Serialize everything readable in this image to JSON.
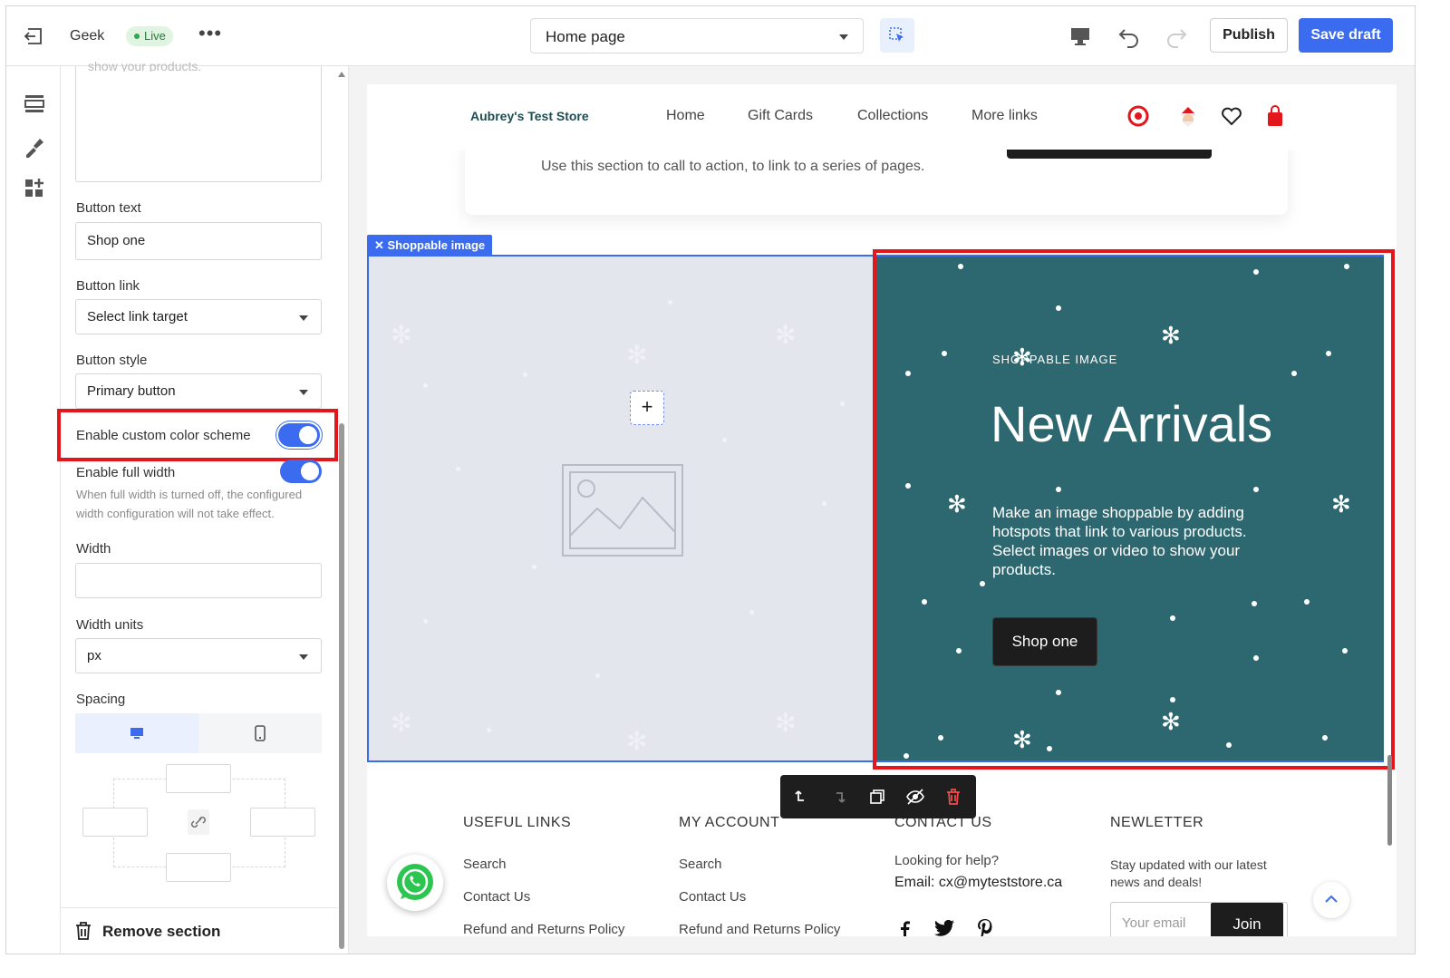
{
  "topbar": {
    "store_name": "Geek",
    "live_badge": "Live",
    "more": "•••",
    "page_select": "Home page",
    "publish": "Publish",
    "save_draft": "Save draft"
  },
  "panel": {
    "textarea_ghost": "show your products.",
    "button_text_label": "Button text",
    "button_text_value": "Shop one",
    "button_link_label": "Button link",
    "button_link_value": "Select link target",
    "button_style_label": "Button style",
    "button_style_value": "Primary button",
    "custom_color_label": "Enable custom color scheme",
    "custom_color_on": true,
    "full_width_label": "Enable full width",
    "full_width_on": true,
    "full_width_hint": "When full width is turned off, the configured width configuration will not take effect.",
    "width_label": "Width",
    "width_value": "",
    "width_units_label": "Width units",
    "width_units_value": "px",
    "spacing_label": "Spacing",
    "remove_section": "Remove section"
  },
  "store": {
    "logo": "Aubrey's Test Store",
    "nav": [
      "Home",
      "Gift Cards",
      "Collections",
      "More links"
    ],
    "cta_text": "Use this section to call to action, to link to a series of pages.",
    "section_tag": "Shoppable image",
    "kicker": "SHOPPABLE IMAGE",
    "headline": "New Arrivals",
    "description": "Make an image shoppable by adding hotspots that link to various products. Select images or video to show your products.",
    "shop_button": "Shop one"
  },
  "footer": {
    "useful_links_title": "USEFUL LINKS",
    "useful_links": [
      "Search",
      "Contact Us",
      "Refund and Returns Policy"
    ],
    "my_account_title": "MY ACCOUNT",
    "my_account_links": [
      "Search",
      "Contact Us",
      "Refund and Returns Policy"
    ],
    "contact_title": "CONTACT US",
    "contact_help": "Looking for help?",
    "contact_email": "Email: cx@myteststore.ca",
    "newsletter_title": "NEWLETTER",
    "newsletter_text": "Stay updated with our latest news and deals!",
    "email_placeholder": "Your email",
    "join": "Join"
  },
  "colors": {
    "accent": "#3b6cf0",
    "teal": "#2d6871",
    "highlight": "#e3161b",
    "live": "#2fa84f"
  }
}
